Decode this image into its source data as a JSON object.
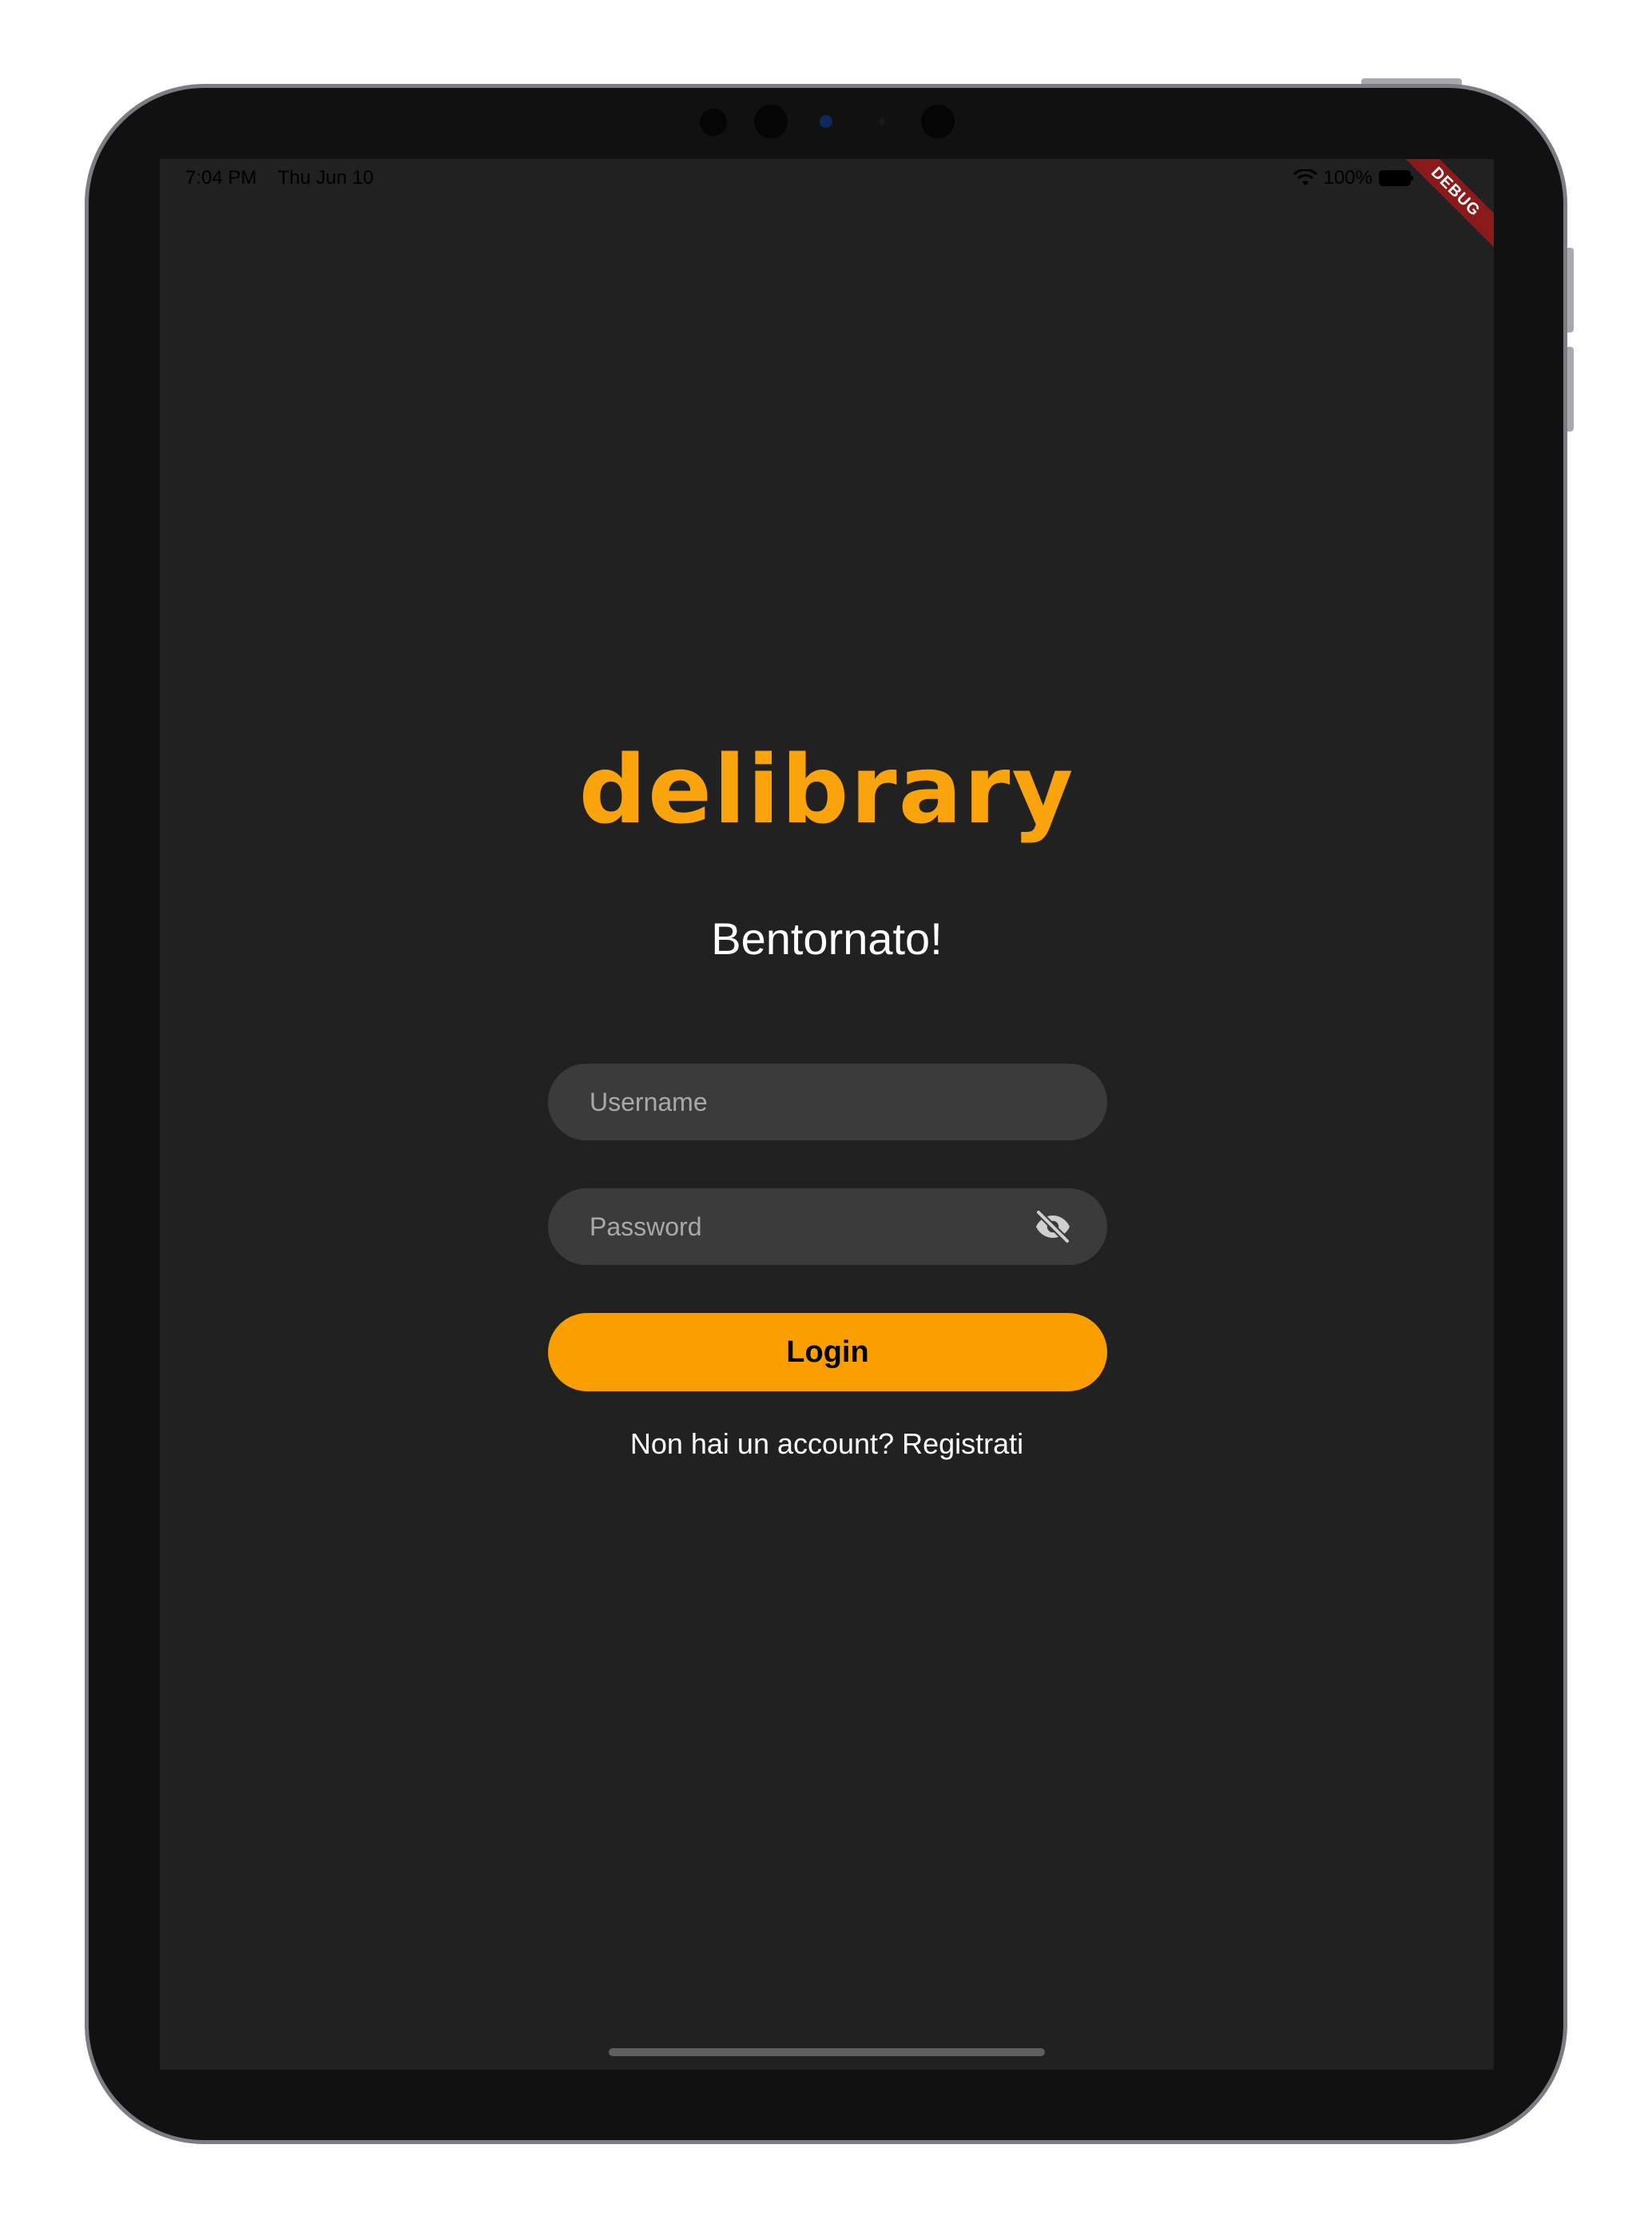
{
  "status_bar": {
    "time": "7:04 PM",
    "date": "Thu Jun 10",
    "battery": "100%",
    "wifi_icon": "wifi-icon",
    "battery_icon": "battery-icon"
  },
  "debug_banner": "DEBUG",
  "app": {
    "logo": "delibrary",
    "welcome": "Bentornato!",
    "username": {
      "placeholder": "Username",
      "value": ""
    },
    "password": {
      "placeholder": "Password",
      "value": "",
      "toggle_icon": "eye-off-icon"
    },
    "login_label": "Login",
    "register_text": "Non hai un account? Registrati"
  },
  "colors": {
    "background": "#212121",
    "accent": "#fb9e00",
    "logo": "#f9a40d",
    "field": "#3b3b3b",
    "text": "#ffffff"
  }
}
